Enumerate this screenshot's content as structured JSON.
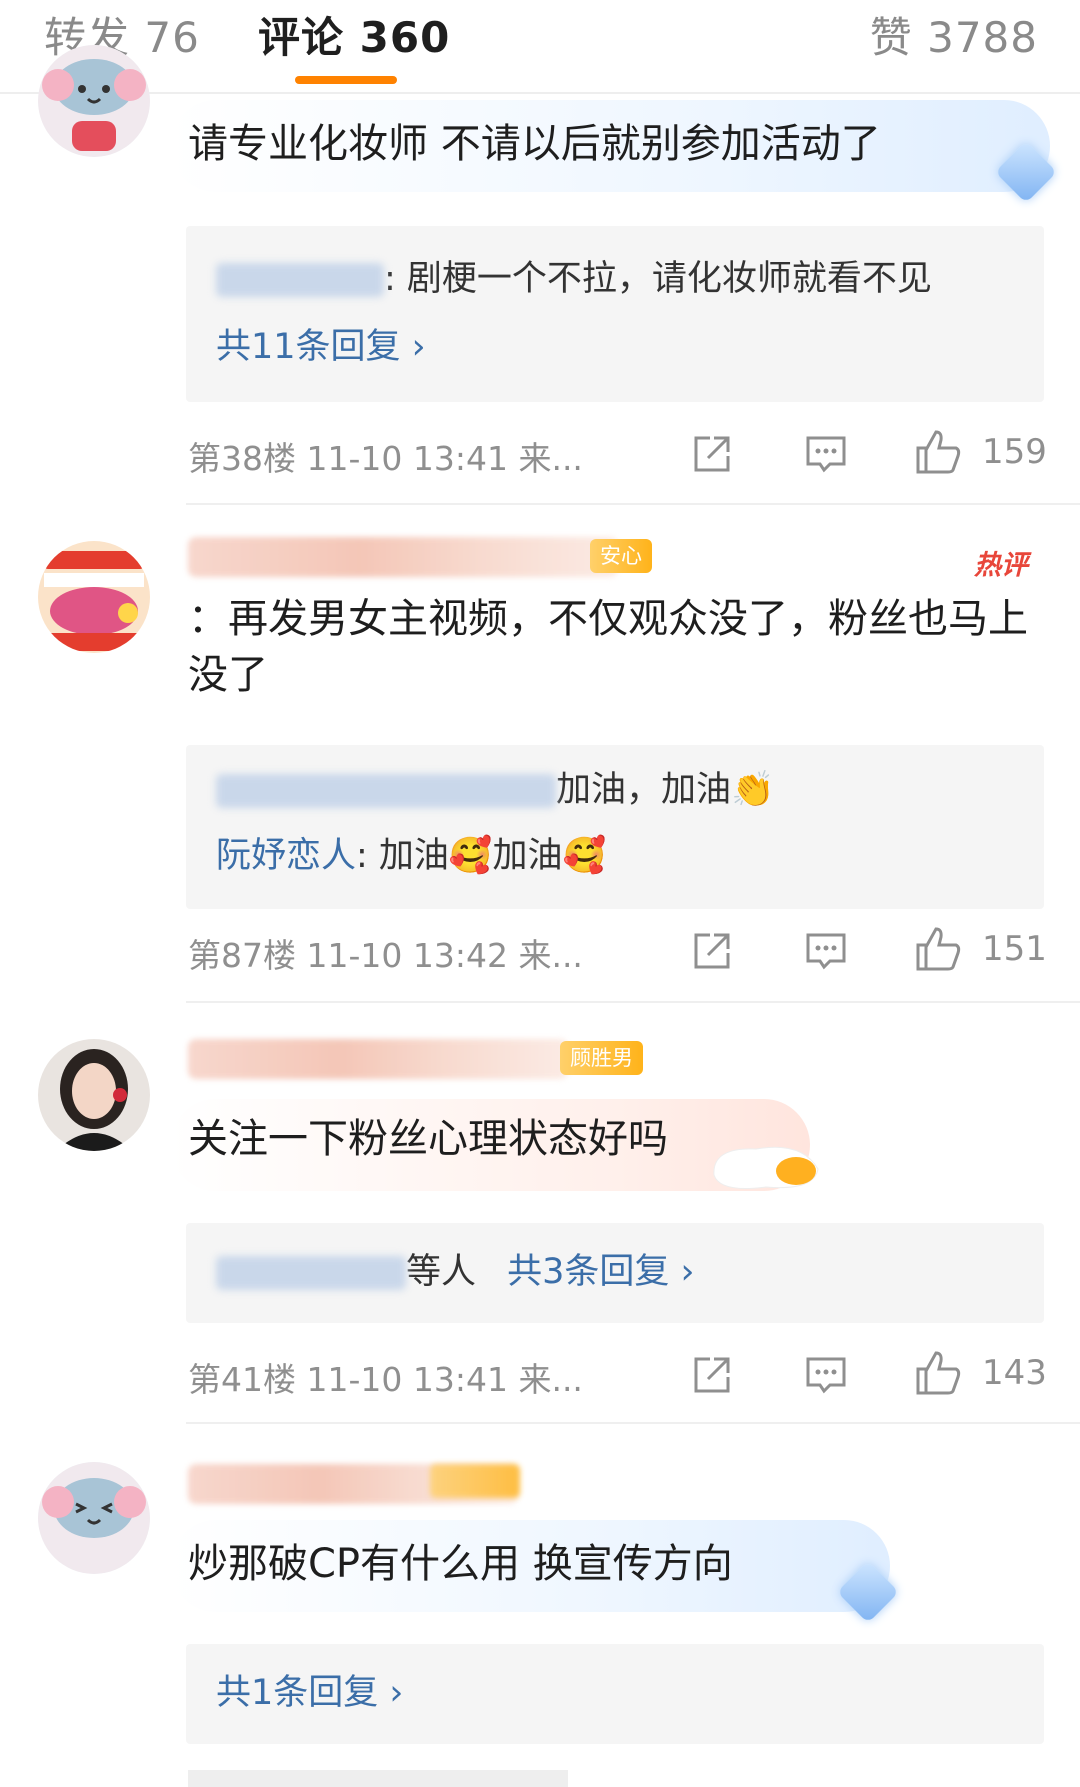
{
  "tabs": {
    "repost": "转发 76",
    "comments": "评论 360",
    "likes": "赞 3788"
  },
  "comments": [
    {
      "text": "请专业化妆师 不请以后就别参加活动了",
      "replies": {
        "line1_suffix": ": 剧梗一个不拉，请化妆师就看不见",
        "more": "共11条回复 ›"
      },
      "meta": "第38楼 11-10 13:41 来...",
      "likes": "159"
    },
    {
      "badge": "安心",
      "hot": "热评",
      "text": "：再发男女主视频，不仅观众没了，粉丝也马上没了",
      "replies": {
        "line1_suffix": "加油，加油👏",
        "line2_name": "阮妤恋人",
        "line2_text": ": 加油🥰加油🥰"
      },
      "meta": "第87楼 11-10 13:42 来...",
      "likes": "151"
    },
    {
      "badge": "顾胜男",
      "text": "关注一下粉丝心理状态好吗",
      "replies": {
        "suffix": "等人",
        "more": "共3条回复 ›"
      },
      "meta": "第41楼 11-10 13:41 来...",
      "likes": "143"
    },
    {
      "text": "炒那破CP有什么用 换宣传方向",
      "replies": {
        "more": "共1条回复 ›"
      }
    }
  ],
  "colors": {
    "accent": "#ff8200",
    "link": "#3b6ea8",
    "hot": "#e8463a"
  }
}
